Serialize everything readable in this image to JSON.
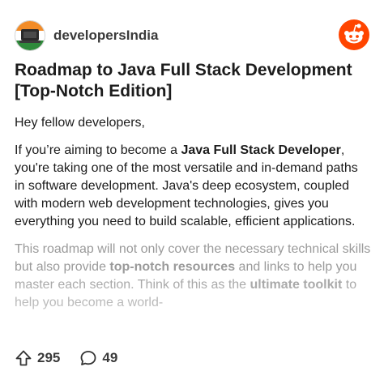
{
  "subreddit": {
    "name": "developersIndia",
    "avatar_icon": "india-flag-laptop-icon"
  },
  "app_logo_icon": "reddit-snoo-icon",
  "post": {
    "title": "Roadmap to Java Full Stack Development [Top-Notch Edition]",
    "greeting": "Hey fellow developers,",
    "p1": {
      "t1": "If you’re aiming to become a ",
      "b1": "Java Full Stack Developer",
      "t2": ", you're taking one of the most versatile and in-demand paths in software development. Java's deep ecosystem, coupled with modern web development technologies, gives you everything you need to build scalable, efficient applications."
    },
    "p2": {
      "t1": "This roadmap will not only cover the necessary technical skills but also provide ",
      "b1": "top-notch resources",
      "t2": " and links to help you master each section. Think of this as the ",
      "b2": "ultimate toolkit",
      "t3": " to help you become a world-"
    }
  },
  "stats": {
    "upvotes": "295",
    "comments": "49"
  },
  "colors": {
    "reddit_orange": "#ff4500",
    "text": "#1c1c1c",
    "faded_text": "#9a9a9a"
  }
}
